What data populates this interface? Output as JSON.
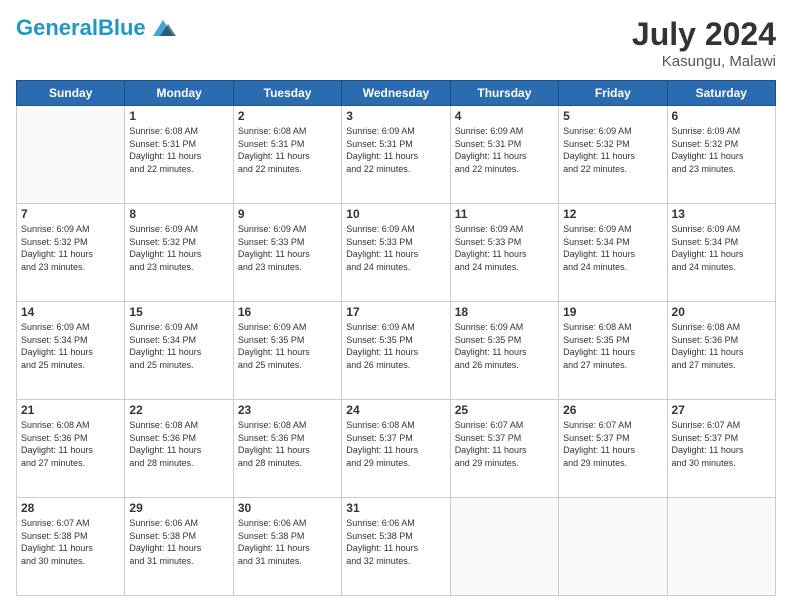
{
  "header": {
    "logo_general": "General",
    "logo_blue": "Blue",
    "month_year": "July 2024",
    "location": "Kasungu, Malawi"
  },
  "days_of_week": [
    "Sunday",
    "Monday",
    "Tuesday",
    "Wednesday",
    "Thursday",
    "Friday",
    "Saturday"
  ],
  "weeks": [
    [
      {
        "day": "",
        "sunrise": "",
        "sunset": "",
        "daylight": ""
      },
      {
        "day": "1",
        "sunrise": "Sunrise: 6:08 AM",
        "sunset": "Sunset: 5:31 PM",
        "daylight": "Daylight: 11 hours and 22 minutes."
      },
      {
        "day": "2",
        "sunrise": "Sunrise: 6:08 AM",
        "sunset": "Sunset: 5:31 PM",
        "daylight": "Daylight: 11 hours and 22 minutes."
      },
      {
        "day": "3",
        "sunrise": "Sunrise: 6:09 AM",
        "sunset": "Sunset: 5:31 PM",
        "daylight": "Daylight: 11 hours and 22 minutes."
      },
      {
        "day": "4",
        "sunrise": "Sunrise: 6:09 AM",
        "sunset": "Sunset: 5:31 PM",
        "daylight": "Daylight: 11 hours and 22 minutes."
      },
      {
        "day": "5",
        "sunrise": "Sunrise: 6:09 AM",
        "sunset": "Sunset: 5:32 PM",
        "daylight": "Daylight: 11 hours and 22 minutes."
      },
      {
        "day": "6",
        "sunrise": "Sunrise: 6:09 AM",
        "sunset": "Sunset: 5:32 PM",
        "daylight": "Daylight: 11 hours and 23 minutes."
      }
    ],
    [
      {
        "day": "7",
        "sunrise": "Sunrise: 6:09 AM",
        "sunset": "Sunset: 5:32 PM",
        "daylight": "Daylight: 11 hours and 23 minutes."
      },
      {
        "day": "8",
        "sunrise": "Sunrise: 6:09 AM",
        "sunset": "Sunset: 5:32 PM",
        "daylight": "Daylight: 11 hours and 23 minutes."
      },
      {
        "day": "9",
        "sunrise": "Sunrise: 6:09 AM",
        "sunset": "Sunset: 5:33 PM",
        "daylight": "Daylight: 11 hours and 23 minutes."
      },
      {
        "day": "10",
        "sunrise": "Sunrise: 6:09 AM",
        "sunset": "Sunset: 5:33 PM",
        "daylight": "Daylight: 11 hours and 24 minutes."
      },
      {
        "day": "11",
        "sunrise": "Sunrise: 6:09 AM",
        "sunset": "Sunset: 5:33 PM",
        "daylight": "Daylight: 11 hours and 24 minutes."
      },
      {
        "day": "12",
        "sunrise": "Sunrise: 6:09 AM",
        "sunset": "Sunset: 5:34 PM",
        "daylight": "Daylight: 11 hours and 24 minutes."
      },
      {
        "day": "13",
        "sunrise": "Sunrise: 6:09 AM",
        "sunset": "Sunset: 5:34 PM",
        "daylight": "Daylight: 11 hours and 24 minutes."
      }
    ],
    [
      {
        "day": "14",
        "sunrise": "Sunrise: 6:09 AM",
        "sunset": "Sunset: 5:34 PM",
        "daylight": "Daylight: 11 hours and 25 minutes."
      },
      {
        "day": "15",
        "sunrise": "Sunrise: 6:09 AM",
        "sunset": "Sunset: 5:34 PM",
        "daylight": "Daylight: 11 hours and 25 minutes."
      },
      {
        "day": "16",
        "sunrise": "Sunrise: 6:09 AM",
        "sunset": "Sunset: 5:35 PM",
        "daylight": "Daylight: 11 hours and 25 minutes."
      },
      {
        "day": "17",
        "sunrise": "Sunrise: 6:09 AM",
        "sunset": "Sunset: 5:35 PM",
        "daylight": "Daylight: 11 hours and 26 minutes."
      },
      {
        "day": "18",
        "sunrise": "Sunrise: 6:09 AM",
        "sunset": "Sunset: 5:35 PM",
        "daylight": "Daylight: 11 hours and 26 minutes."
      },
      {
        "day": "19",
        "sunrise": "Sunrise: 6:08 AM",
        "sunset": "Sunset: 5:35 PM",
        "daylight": "Daylight: 11 hours and 27 minutes."
      },
      {
        "day": "20",
        "sunrise": "Sunrise: 6:08 AM",
        "sunset": "Sunset: 5:36 PM",
        "daylight": "Daylight: 11 hours and 27 minutes."
      }
    ],
    [
      {
        "day": "21",
        "sunrise": "Sunrise: 6:08 AM",
        "sunset": "Sunset: 5:36 PM",
        "daylight": "Daylight: 11 hours and 27 minutes."
      },
      {
        "day": "22",
        "sunrise": "Sunrise: 6:08 AM",
        "sunset": "Sunset: 5:36 PM",
        "daylight": "Daylight: 11 hours and 28 minutes."
      },
      {
        "day": "23",
        "sunrise": "Sunrise: 6:08 AM",
        "sunset": "Sunset: 5:36 PM",
        "daylight": "Daylight: 11 hours and 28 minutes."
      },
      {
        "day": "24",
        "sunrise": "Sunrise: 6:08 AM",
        "sunset": "Sunset: 5:37 PM",
        "daylight": "Daylight: 11 hours and 29 minutes."
      },
      {
        "day": "25",
        "sunrise": "Sunrise: 6:07 AM",
        "sunset": "Sunset: 5:37 PM",
        "daylight": "Daylight: 11 hours and 29 minutes."
      },
      {
        "day": "26",
        "sunrise": "Sunrise: 6:07 AM",
        "sunset": "Sunset: 5:37 PM",
        "daylight": "Daylight: 11 hours and 29 minutes."
      },
      {
        "day": "27",
        "sunrise": "Sunrise: 6:07 AM",
        "sunset": "Sunset: 5:37 PM",
        "daylight": "Daylight: 11 hours and 30 minutes."
      }
    ],
    [
      {
        "day": "28",
        "sunrise": "Sunrise: 6:07 AM",
        "sunset": "Sunset: 5:38 PM",
        "daylight": "Daylight: 11 hours and 30 minutes."
      },
      {
        "day": "29",
        "sunrise": "Sunrise: 6:06 AM",
        "sunset": "Sunset: 5:38 PM",
        "daylight": "Daylight: 11 hours and 31 minutes."
      },
      {
        "day": "30",
        "sunrise": "Sunrise: 6:06 AM",
        "sunset": "Sunset: 5:38 PM",
        "daylight": "Daylight: 11 hours and 31 minutes."
      },
      {
        "day": "31",
        "sunrise": "Sunrise: 6:06 AM",
        "sunset": "Sunset: 5:38 PM",
        "daylight": "Daylight: 11 hours and 32 minutes."
      },
      {
        "day": "",
        "sunrise": "",
        "sunset": "",
        "daylight": ""
      },
      {
        "day": "",
        "sunrise": "",
        "sunset": "",
        "daylight": ""
      },
      {
        "day": "",
        "sunrise": "",
        "sunset": "",
        "daylight": ""
      }
    ]
  ]
}
